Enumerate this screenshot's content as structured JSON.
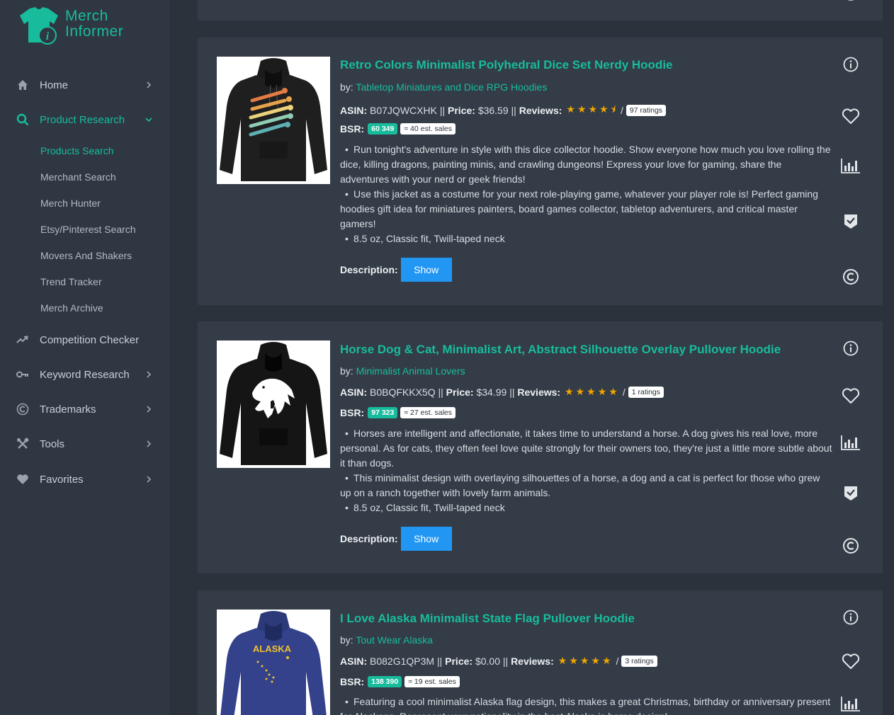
{
  "brand": {
    "line1": "Merch",
    "line2": "Informer"
  },
  "sidebar": {
    "items": [
      {
        "label": "Home"
      },
      {
        "label": "Product Research"
      },
      {
        "label": "Competition Checker"
      },
      {
        "label": "Keyword Research"
      },
      {
        "label": "Trademarks"
      },
      {
        "label": "Tools"
      },
      {
        "label": "Favorites"
      }
    ],
    "sub_items": [
      {
        "label": "Products Search"
      },
      {
        "label": "Merchant Search"
      },
      {
        "label": "Merch Hunter"
      },
      {
        "label": "Etsy/Pinterest Search"
      },
      {
        "label": "Movers And Shakers"
      },
      {
        "label": "Trend Tracker"
      },
      {
        "label": "Merch Archive"
      }
    ]
  },
  "labels": {
    "by": "by:",
    "asin": "ASIN:",
    "price": "Price:",
    "reviews": "Reviews:",
    "bsr": "BSR:",
    "description": "Description:",
    "show": "Show",
    "sep": "||",
    "slash": "/"
  },
  "products": [
    {
      "title": "Retro Colors Minimalist Polyhedral Dice Set Nerdy Hoodie",
      "brand": "Tabletop Miniatures and Dice RPG Hoodies",
      "asin": "B07JQWCXHK",
      "price": "$36.59",
      "rating": 4.5,
      "stars": "★★★★⯨",
      "ratings": "97 ratings",
      "bsr": "60 349",
      "sales": "≈ 40 est. sales",
      "bullets": [
        "Run tonight's adventure in style with this dice collector hoodie. Show everyone how much you love rolling the dice, killing dragons, painting minis, and crawling dungeons! Express your love for gaming, share the adventures with your nerd or geek friends!",
        "Use this jacket as a costume for your next role-playing game, whatever your player role is! Perfect gaming hoodies gift idea for miniatures painters, board games collector, tabletop adventurers, and critical master gamers!",
        "8.5 oz, Classic fit, Twill-taped neck"
      ]
    },
    {
      "title": "Horse Dog & Cat, Minimalist Art, Abstract Silhouette Overlay Pullover Hoodie",
      "brand": "Minimalist Animal Lovers",
      "asin": "B0BQFKKX5Q",
      "price": "$34.99",
      "rating": 5,
      "stars": "★★★★★",
      "ratings": "1 ratings",
      "bsr": "97 323",
      "sales": "≈ 27 est. sales",
      "bullets": [
        "Horses are intelligent and affectionate, it takes time to understand a horse. A dog gives his real love, more personal. As for cats, they often feel love quite strongly for their owners too, they're just a little more subtle about it than dogs.",
        "This minimalist design with overlaying silhouettes of a horse, a dog and a cat is perfect for those who grew up on a ranch together with lovely farm animals.",
        "8.5 oz, Classic fit, Twill-taped neck"
      ]
    },
    {
      "title": "I Love Alaska Minimalist State Flag Pullover Hoodie",
      "brand": "Tout Wear Alaska",
      "asin": "B082G1QP3M",
      "price": "$0.00",
      "rating": 5,
      "stars": "★★★★★",
      "ratings": "3 ratings",
      "bsr": "138 390",
      "sales": "≈ 19 est. sales",
      "print_text": "ALASKA",
      "bullets": [
        "Featuring a cool minimalist Alaska flag design, this makes a great Christmas, birthday or anniversary present for Alaskans. Represent your nationality in the best Alaska is home design!"
      ]
    }
  ],
  "colors": {
    "accent": "#18bc9c",
    "button": "#2196f3",
    "star": "#f0a500",
    "card": "#343c47",
    "bg": "#2b323c"
  }
}
